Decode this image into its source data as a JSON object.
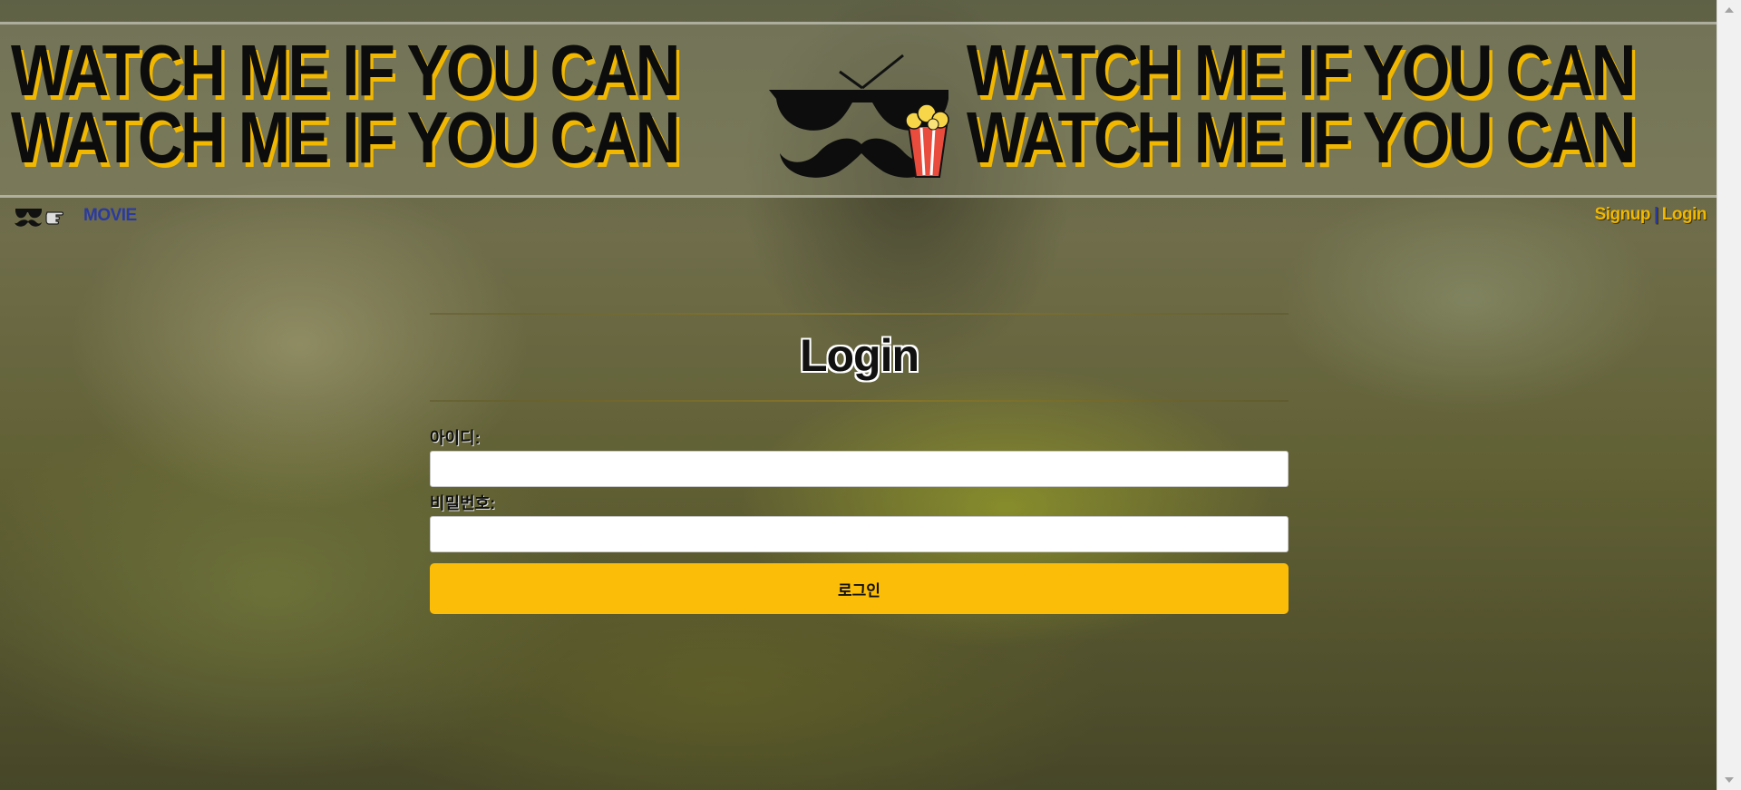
{
  "banner": {
    "lines": [
      "WATCH ME IF YOU CAN",
      "WATCH ME IF YOU CAN"
    ],
    "logo_icon": "sunglasses-mustache-icon",
    "popcorn_icon": "popcorn-icon"
  },
  "navbar": {
    "brand_icon": "mustache-pointing-hand-icon",
    "brand_label": "MOVIE",
    "signup_label": "Signup",
    "separator": "|",
    "login_label": "Login"
  },
  "login": {
    "title": "Login",
    "id_label": "아이디:",
    "id_value": "",
    "password_label": "비밀번호:",
    "password_value": "",
    "submit_label": "로그인"
  },
  "colors": {
    "accent": "#fbbd07",
    "brand_link": "#2a3aa0"
  }
}
